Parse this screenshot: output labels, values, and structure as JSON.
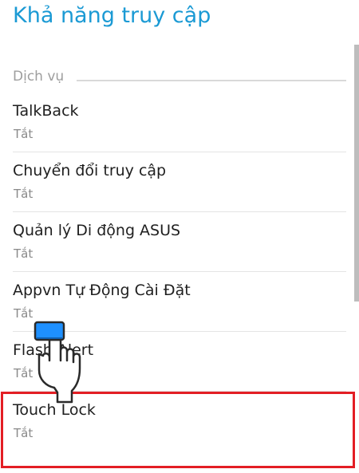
{
  "header": {
    "title": "Khả năng truy cập"
  },
  "section": {
    "label": "Dịch vụ"
  },
  "items": [
    {
      "title": "TalkBack",
      "status": "Tắt"
    },
    {
      "title": "Chuyển đổi truy cập",
      "status": "Tắt"
    },
    {
      "title": "Quản lý Di động ASUS",
      "status": "Tắt"
    },
    {
      "title": "Appvn Tự Động Cài Đặt",
      "status": "Tắt"
    },
    {
      "title": "Flash Alert",
      "status": "Tắt"
    },
    {
      "title": "Touch Lock",
      "status": "Tắt"
    }
  ],
  "colors": {
    "accent": "#1b9ad4",
    "highlight_border": "#e31e24",
    "hand_cursor_tip": "#1e90ff"
  },
  "icons": {
    "cursor": "pointing-hand-icon"
  }
}
